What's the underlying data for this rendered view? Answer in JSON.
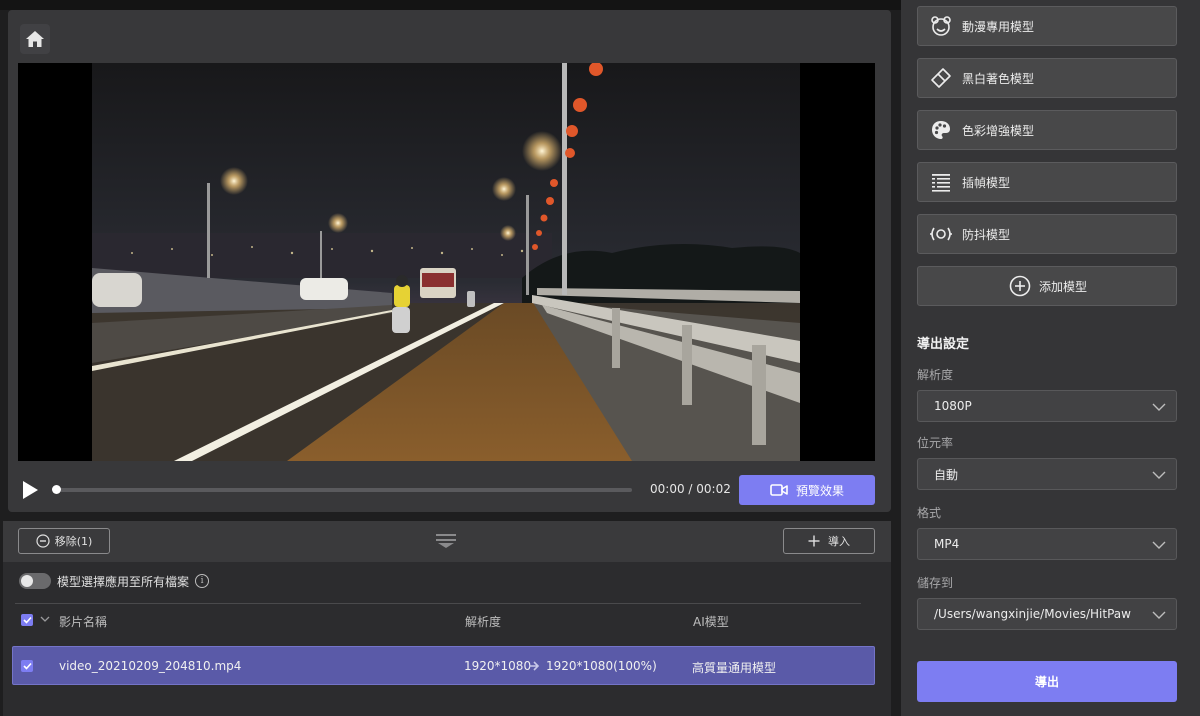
{
  "toolbar": {
    "home_icon": "home-icon"
  },
  "player": {
    "time": "00:00 / 00:02",
    "progress": 0,
    "preview_label": "預覽效果"
  },
  "files": {
    "remove_label": "移除(1)",
    "import_label": "導入",
    "toggle_label": "模型選擇應用至所有檔案",
    "toggle_on": false,
    "columns": {
      "name": "影片名稱",
      "resolution": "解析度",
      "model": "AI模型"
    },
    "rows": [
      {
        "checked": true,
        "name": "video_20210209_204810.mp4",
        "res_from": "1920*1080",
        "res_to": "1920*1080(100%)",
        "model": "高質量通用模型"
      }
    ]
  },
  "models": [
    {
      "label": "動漫專用模型",
      "icon": "anime-bear-icon"
    },
    {
      "label": "黑白著色模型",
      "icon": "eraser-icon"
    },
    {
      "label": "色彩增強模型",
      "icon": "palette-icon"
    },
    {
      "label": "插幀模型",
      "icon": "frame-list-icon"
    },
    {
      "label": "防抖模型",
      "icon": "stabilize-icon"
    }
  ],
  "add_model_label": "添加模型",
  "export": {
    "title": "導出設定",
    "resolution_label": "解析度",
    "resolution_value": "1080P",
    "bitrate_label": "位元率",
    "bitrate_value": "自動",
    "format_label": "格式",
    "format_value": "MP4",
    "save_label": "儲存到",
    "save_value": "/Users/wangxinjie/Movies/HitPaw",
    "export_label": "導出"
  },
  "colors": {
    "accent": "#7d7df2",
    "row_selected": "#5a5aa8"
  }
}
